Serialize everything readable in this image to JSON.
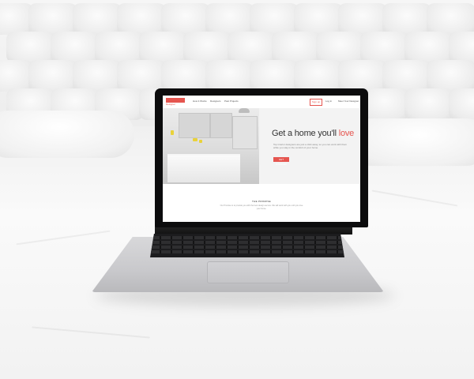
{
  "site": {
    "logo_text": "Designer",
    "nav_links": [
      "How it Works",
      "Designers",
      "Past Projects"
    ],
    "signup_label": "Sign up",
    "login_label": "Log in",
    "right_link": "Meet Your Designer",
    "hero_title": "Get a home you'll",
    "hero_title_accent": "love",
    "hero_subtitle": "Top interior designers are just a click away, so you can work with them while you stay in the comfort of your home.",
    "cta_label": "GET STARTED",
    "promise_title": "THE PROMISE",
    "promise_text": "Our Promise is to provide you with the best design service. We will work with you until you love your home."
  },
  "colors": {
    "accent": "#e5554f",
    "screen_bg": "#ffffff",
    "bezel": "#0c0c0d"
  }
}
